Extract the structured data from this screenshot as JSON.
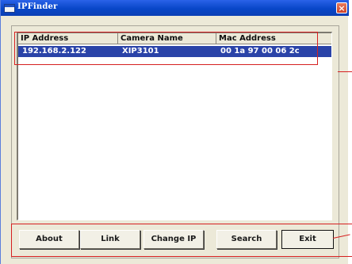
{
  "window": {
    "title": "IPFinder",
    "close_glyph": "×"
  },
  "list": {
    "columns": [
      "IP Address",
      "Camera Name",
      "Mac Address"
    ],
    "rows": [
      [
        "192.168.2.122",
        "XIP3101",
        "00 1a 97 00 06 2c"
      ]
    ]
  },
  "buttons": {
    "about": "About",
    "link": "Link",
    "change_ip": "Change IP",
    "search": "Search",
    "exit": "Exit"
  },
  "colors": {
    "titlebar": "#0846c8",
    "selection": "#2a43a8",
    "annotation": "#d62020"
  }
}
